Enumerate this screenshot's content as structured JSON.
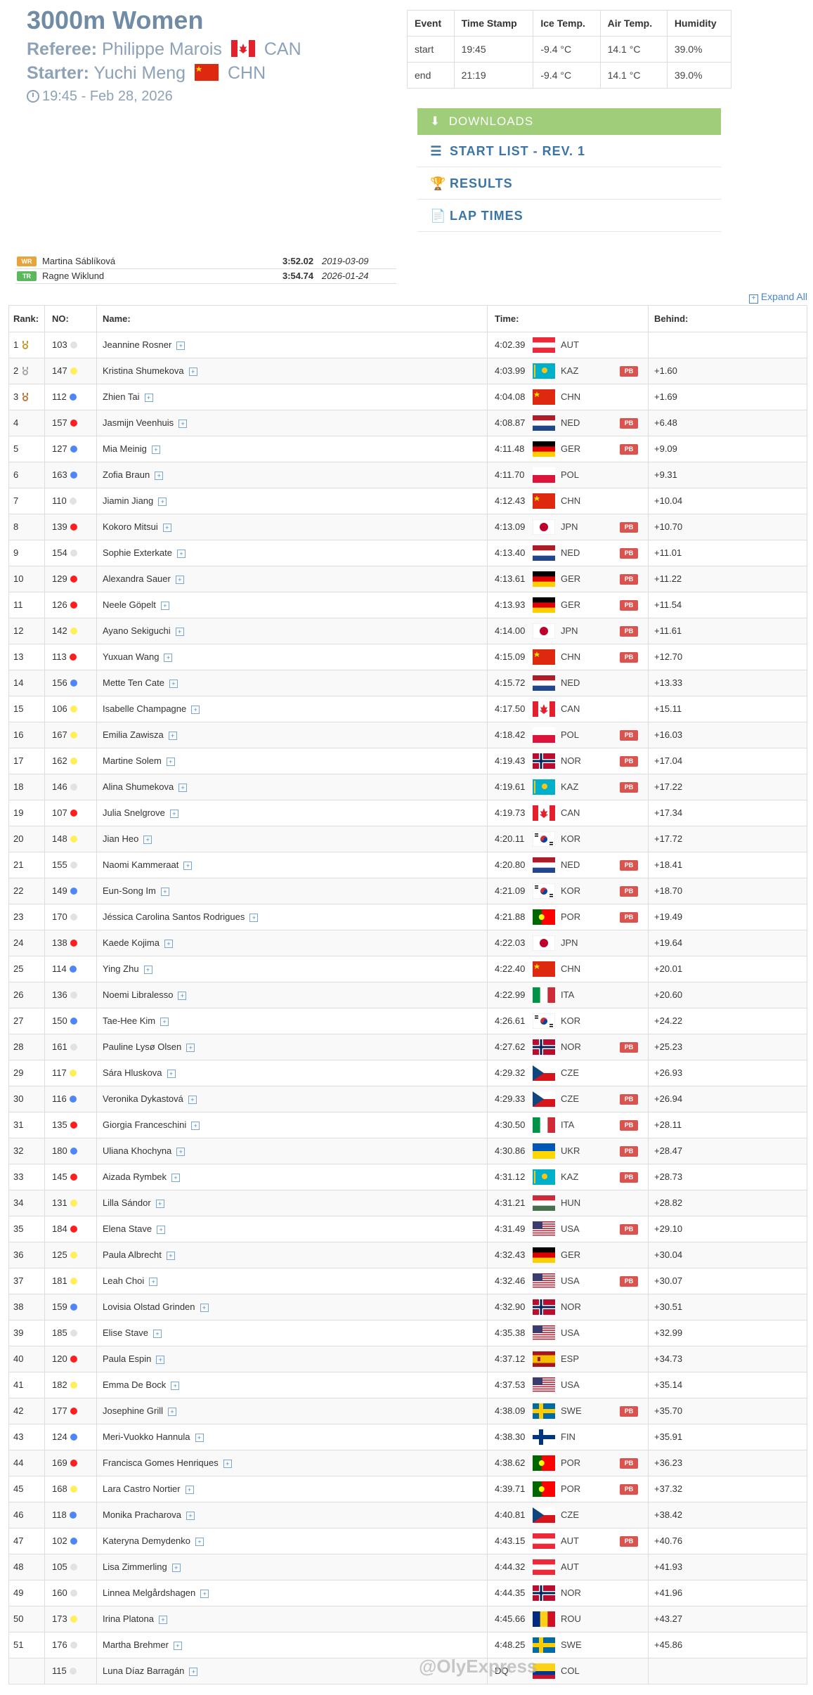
{
  "header": {
    "title": "3000m Women",
    "referee_label": "Referee:",
    "referee_name": "Philippe Marois",
    "referee_noc": "CAN",
    "starter_label": "Starter:",
    "starter_name": "Yuchi Meng",
    "starter_noc": "CHN",
    "datetime": "19:45 - Feb 28, 2026"
  },
  "conditions": {
    "headers": [
      "Event",
      "Time Stamp",
      "Ice Temp.",
      "Air Temp.",
      "Humidity"
    ],
    "rows": [
      [
        "start",
        "19:45",
        "-9.4 °C",
        "14.1 °C",
        "39.0%"
      ],
      [
        "end",
        "21:19",
        "-9.4 °C",
        "14.1 °C",
        "39.0%"
      ]
    ]
  },
  "downloads": {
    "title": "DOWNLOADS",
    "items": [
      "START LIST - REV. 1",
      "RESULTS",
      "LAP TIMES"
    ]
  },
  "records": [
    {
      "badge": "WR",
      "name": "Martina Sáblíková",
      "time": "3:52.02",
      "date": "2019-03-09",
      "color": "#e8a33a"
    },
    {
      "badge": "TR",
      "name": "Ragne Wiklund",
      "time": "3:54.74",
      "date": "2026-01-24",
      "color": "#5cb85c"
    }
  ],
  "expand_all": "Expand All",
  "table": {
    "headers": {
      "rank": "Rank:",
      "no": "NO:",
      "name": "Name:",
      "time": "Time:",
      "behind": "Behind:"
    },
    "pb_label": "PB",
    "rows": [
      {
        "rank": "1",
        "medal": "gold",
        "no": "103",
        "dot": "white",
        "name": "Jeannine Rosner",
        "noc": "AUT",
        "time": "4:02.39",
        "pb": false,
        "behind": ""
      },
      {
        "rank": "2",
        "medal": "silver",
        "no": "147",
        "dot": "yellow",
        "name": "Kristina Shumekova",
        "noc": "KAZ",
        "time": "4:03.99",
        "pb": true,
        "behind": "+1.60"
      },
      {
        "rank": "3",
        "medal": "bronze",
        "no": "112",
        "dot": "blue",
        "name": "Zhien Tai",
        "noc": "CHN",
        "time": "4:04.08",
        "pb": false,
        "behind": "+1.69"
      },
      {
        "rank": "4",
        "no": "157",
        "dot": "red",
        "name": "Jasmijn Veenhuis",
        "noc": "NED",
        "time": "4:08.87",
        "pb": true,
        "behind": "+6.48"
      },
      {
        "rank": "5",
        "no": "127",
        "dot": "blue",
        "name": "Mia Meinig",
        "noc": "GER",
        "time": "4:11.48",
        "pb": true,
        "behind": "+9.09"
      },
      {
        "rank": "6",
        "no": "163",
        "dot": "blue",
        "name": "Zofia Braun",
        "noc": "POL",
        "time": "4:11.70",
        "pb": false,
        "behind": "+9.31"
      },
      {
        "rank": "7",
        "no": "110",
        "dot": "white",
        "name": "Jiamin Jiang",
        "noc": "CHN",
        "time": "4:12.43",
        "pb": false,
        "behind": "+10.04"
      },
      {
        "rank": "8",
        "no": "139",
        "dot": "red",
        "name": "Kokoro Mitsui",
        "noc": "JPN",
        "time": "4:13.09",
        "pb": true,
        "behind": "+10.70"
      },
      {
        "rank": "9",
        "no": "154",
        "dot": "white",
        "name": "Sophie Exterkate",
        "noc": "NED",
        "time": "4:13.40",
        "pb": true,
        "behind": "+11.01"
      },
      {
        "rank": "10",
        "no": "129",
        "dot": "red",
        "name": "Alexandra Sauer",
        "noc": "GER",
        "time": "4:13.61",
        "pb": true,
        "behind": "+11.22"
      },
      {
        "rank": "11",
        "no": "126",
        "dot": "red",
        "name": "Neele Göpelt",
        "noc": "GER",
        "time": "4:13.93",
        "pb": true,
        "behind": "+11.54"
      },
      {
        "rank": "12",
        "no": "142",
        "dot": "yellow",
        "name": "Ayano Sekiguchi",
        "noc": "JPN",
        "time": "4:14.00",
        "pb": true,
        "behind": "+11.61"
      },
      {
        "rank": "13",
        "no": "113",
        "dot": "red",
        "name": "Yuxuan Wang",
        "noc": "CHN",
        "time": "4:15.09",
        "pb": true,
        "behind": "+12.70"
      },
      {
        "rank": "14",
        "no": "156",
        "dot": "blue",
        "name": "Mette Ten Cate",
        "noc": "NED",
        "time": "4:15.72",
        "pb": false,
        "behind": "+13.33"
      },
      {
        "rank": "15",
        "no": "106",
        "dot": "yellow",
        "name": "Isabelle Champagne",
        "noc": "CAN",
        "time": "4:17.50",
        "pb": false,
        "behind": "+15.11"
      },
      {
        "rank": "16",
        "no": "167",
        "dot": "yellow",
        "name": "Emilia Zawisza",
        "noc": "POL",
        "time": "4:18.42",
        "pb": true,
        "behind": "+16.03"
      },
      {
        "rank": "17",
        "no": "162",
        "dot": "yellow",
        "name": "Martine Solem",
        "noc": "NOR",
        "time": "4:19.43",
        "pb": true,
        "behind": "+17.04"
      },
      {
        "rank": "18",
        "no": "146",
        "dot": "white",
        "name": "Alina Shumekova",
        "noc": "KAZ",
        "time": "4:19.61",
        "pb": true,
        "behind": "+17.22"
      },
      {
        "rank": "19",
        "no": "107",
        "dot": "red",
        "name": "Julia Snelgrove",
        "noc": "CAN",
        "time": "4:19.73",
        "pb": false,
        "behind": "+17.34"
      },
      {
        "rank": "20",
        "no": "148",
        "dot": "yellow",
        "name": "Jian Heo",
        "noc": "KOR",
        "time": "4:20.11",
        "pb": false,
        "behind": "+17.72"
      },
      {
        "rank": "21",
        "no": "155",
        "dot": "white",
        "name": "Naomi Kammeraat",
        "noc": "NED",
        "time": "4:20.80",
        "pb": true,
        "behind": "+18.41"
      },
      {
        "rank": "22",
        "no": "149",
        "dot": "blue",
        "name": "Eun-Song Im",
        "noc": "KOR",
        "time": "4:21.09",
        "pb": true,
        "behind": "+18.70"
      },
      {
        "rank": "23",
        "no": "170",
        "dot": "white",
        "name": "Jéssica Carolina Santos Rodrigues",
        "noc": "POR",
        "time": "4:21.88",
        "pb": true,
        "behind": "+19.49"
      },
      {
        "rank": "24",
        "no": "138",
        "dot": "red",
        "name": "Kaede Kojima",
        "noc": "JPN",
        "time": "4:22.03",
        "pb": false,
        "behind": "+19.64"
      },
      {
        "rank": "25",
        "no": "114",
        "dot": "blue",
        "name": "Ying Zhu",
        "noc": "CHN",
        "time": "4:22.40",
        "pb": false,
        "behind": "+20.01"
      },
      {
        "rank": "26",
        "no": "136",
        "dot": "white",
        "name": "Noemi Libralesso",
        "noc": "ITA",
        "time": "4:22.99",
        "pb": false,
        "behind": "+20.60"
      },
      {
        "rank": "27",
        "no": "150",
        "dot": "blue",
        "name": "Tae-Hee Kim",
        "noc": "KOR",
        "time": "4:26.61",
        "pb": false,
        "behind": "+24.22"
      },
      {
        "rank": "28",
        "no": "161",
        "dot": "white",
        "name": "Pauline Lysø Olsen",
        "noc": "NOR",
        "time": "4:27.62",
        "pb": true,
        "behind": "+25.23"
      },
      {
        "rank": "29",
        "no": "117",
        "dot": "yellow",
        "name": "Sára Hluskova",
        "noc": "CZE",
        "time": "4:29.32",
        "pb": false,
        "behind": "+26.93"
      },
      {
        "rank": "30",
        "no": "116",
        "dot": "blue",
        "name": "Veronika Dykastová",
        "noc": "CZE",
        "time": "4:29.33",
        "pb": true,
        "behind": "+26.94"
      },
      {
        "rank": "31",
        "no": "135",
        "dot": "red",
        "name": "Giorgia Franceschini",
        "noc": "ITA",
        "time": "4:30.50",
        "pb": true,
        "behind": "+28.11"
      },
      {
        "rank": "32",
        "no": "180",
        "dot": "blue",
        "name": "Uliana Khochyna",
        "noc": "UKR",
        "time": "4:30.86",
        "pb": true,
        "behind": "+28.47"
      },
      {
        "rank": "33",
        "no": "145",
        "dot": "red",
        "name": "Aizada Rymbek",
        "noc": "KAZ",
        "time": "4:31.12",
        "pb": true,
        "behind": "+28.73"
      },
      {
        "rank": "34",
        "no": "131",
        "dot": "yellow",
        "name": "Lilla Sándor",
        "noc": "HUN",
        "time": "4:31.21",
        "pb": false,
        "behind": "+28.82"
      },
      {
        "rank": "35",
        "no": "184",
        "dot": "red",
        "name": "Elena Stave",
        "noc": "USA",
        "time": "4:31.49",
        "pb": true,
        "behind": "+29.10"
      },
      {
        "rank": "36",
        "no": "125",
        "dot": "yellow",
        "name": "Paula Albrecht",
        "noc": "GER",
        "time": "4:32.43",
        "pb": false,
        "behind": "+30.04"
      },
      {
        "rank": "37",
        "no": "181",
        "dot": "yellow",
        "name": "Leah Choi",
        "noc": "USA",
        "time": "4:32.46",
        "pb": true,
        "behind": "+30.07"
      },
      {
        "rank": "38",
        "no": "159",
        "dot": "blue",
        "name": "Lovisia Olstad Grinden",
        "noc": "NOR",
        "time": "4:32.90",
        "pb": false,
        "behind": "+30.51"
      },
      {
        "rank": "39",
        "no": "185",
        "dot": "white",
        "name": "Elise Stave",
        "noc": "USA",
        "time": "4:35.38",
        "pb": false,
        "behind": "+32.99"
      },
      {
        "rank": "40",
        "no": "120",
        "dot": "red",
        "name": "Paula Espin",
        "noc": "ESP",
        "time": "4:37.12",
        "pb": false,
        "behind": "+34.73"
      },
      {
        "rank": "41",
        "no": "182",
        "dot": "yellow",
        "name": "Emma De Bock",
        "noc": "USA",
        "time": "4:37.53",
        "pb": false,
        "behind": "+35.14"
      },
      {
        "rank": "42",
        "no": "177",
        "dot": "red",
        "name": "Josephine Grill",
        "noc": "SWE",
        "time": "4:38.09",
        "pb": true,
        "behind": "+35.70"
      },
      {
        "rank": "43",
        "no": "124",
        "dot": "blue",
        "name": "Meri-Vuokko Hannula",
        "noc": "FIN",
        "time": "4:38.30",
        "pb": false,
        "behind": "+35.91"
      },
      {
        "rank": "44",
        "no": "169",
        "dot": "red",
        "name": "Francisca Gomes Henriques",
        "noc": "POR",
        "time": "4:38.62",
        "pb": true,
        "behind": "+36.23"
      },
      {
        "rank": "45",
        "no": "168",
        "dot": "yellow",
        "name": "Lara Castro Nortier",
        "noc": "POR",
        "time": "4:39.71",
        "pb": true,
        "behind": "+37.32"
      },
      {
        "rank": "46",
        "no": "118",
        "dot": "blue",
        "name": "Monika Pracharova",
        "noc": "CZE",
        "time": "4:40.81",
        "pb": false,
        "behind": "+38.42"
      },
      {
        "rank": "47",
        "no": "102",
        "dot": "blue",
        "name": "Kateryna Demydenko",
        "noc": "AUT",
        "time": "4:43.15",
        "pb": true,
        "behind": "+40.76"
      },
      {
        "rank": "48",
        "no": "105",
        "dot": "white",
        "name": "Lisa Zimmerling",
        "noc": "AUT",
        "time": "4:44.32",
        "pb": false,
        "behind": "+41.93"
      },
      {
        "rank": "49",
        "no": "160",
        "dot": "white",
        "name": "Linnea Melgårdshagen",
        "noc": "NOR",
        "time": "4:44.35",
        "pb": false,
        "behind": "+41.96"
      },
      {
        "rank": "50",
        "no": "173",
        "dot": "yellow",
        "name": "Irina Platona",
        "noc": "ROU",
        "time": "4:45.66",
        "pb": false,
        "behind": "+43.27"
      },
      {
        "rank": "51",
        "no": "176",
        "dot": "white",
        "name": "Martha Brehmer",
        "noc": "SWE",
        "time": "4:48.25",
        "pb": false,
        "behind": "+45.86"
      },
      {
        "rank": "",
        "no": "115",
        "dot": "white",
        "name": "Luna Díaz Barragán",
        "noc": "COL",
        "time": "DQ",
        "pb": false,
        "behind": ""
      }
    ]
  },
  "watermark": "@OlyExpress",
  "colors": {
    "accent_green": "#9fcd7a",
    "link_blue": "#3b74a7",
    "pb_red": "#d9534f",
    "dot_red": "#ff1e1e",
    "dot_blue": "#4f86f7",
    "dot_yellow": "#ffef5a",
    "dot_white": "#e2e2e2"
  }
}
